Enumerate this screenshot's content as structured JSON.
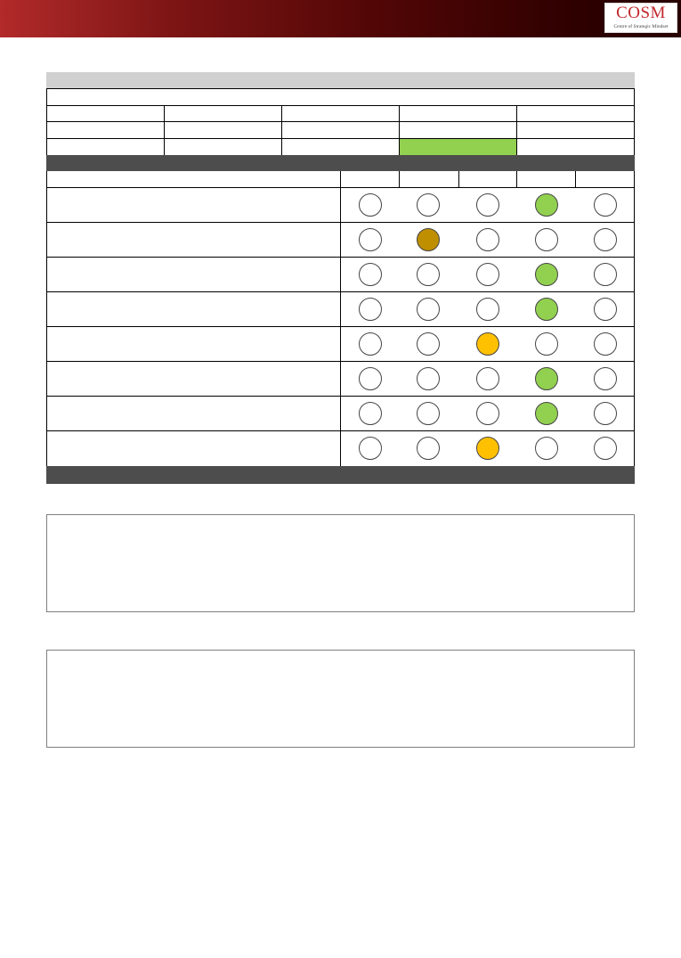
{
  "logo": {
    "text": "COSM",
    "subtitle": "Centre of Strategic Mindset"
  },
  "colors": {
    "empty": "#ffffff",
    "green": "#92d050",
    "amber": "#ffc000",
    "brown": "#bf8f00",
    "header_bar": "#d0d0d0",
    "dark_band": "#4d4d4d"
  },
  "overall_rating_highlight_column": 4,
  "rating_scale_columns": 5,
  "criteria": [
    {
      "selected": 4,
      "color": "green"
    },
    {
      "selected": 2,
      "color": "brown"
    },
    {
      "selected": 4,
      "color": "green"
    },
    {
      "selected": 4,
      "color": "green"
    },
    {
      "selected": 3,
      "color": "amber"
    },
    {
      "selected": 4,
      "color": "green"
    },
    {
      "selected": 4,
      "color": "green"
    },
    {
      "selected": 3,
      "color": "amber"
    }
  ]
}
